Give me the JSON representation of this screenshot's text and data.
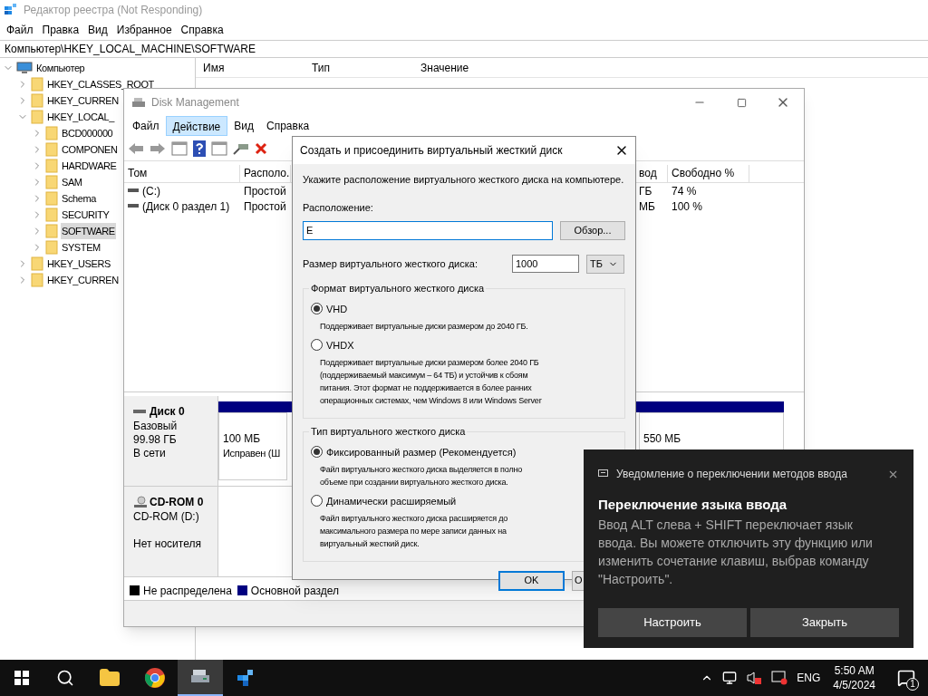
{
  "registry": {
    "title": "Редактор реестра (Not Responding)",
    "menu": [
      "Файл",
      "Правка",
      "Вид",
      "Избранное",
      "Справка"
    ],
    "address": "Компьютер\\HKEY_LOCAL_MACHINE\\SOFTWARE",
    "tree": [
      {
        "label": "Компьютер",
        "kind": "computer",
        "expanded": true,
        "selected": false,
        "children": [
          {
            "label": "HKEY_CLASSES_ROOT",
            "kind": "folder",
            "expanded": false,
            "selected": false
          },
          {
            "label": "HKEY_CURREN",
            "kind": "folder",
            "expanded": false,
            "selected": false
          },
          {
            "label": "HKEY_LOCAL_",
            "kind": "folder",
            "expanded": true,
            "selected": false,
            "children": [
              {
                "label": "BCD000000",
                "kind": "folder",
                "expanded": false,
                "selected": false
              },
              {
                "label": "COMPONEN",
                "kind": "folder",
                "expanded": false,
                "selected": false
              },
              {
                "label": "HARDWARE",
                "kind": "folder",
                "expanded": false,
                "selected": false
              },
              {
                "label": "SAM",
                "kind": "folder",
                "expanded": false,
                "selected": false
              },
              {
                "label": "Schema",
                "kind": "folder",
                "expanded": false,
                "selected": false
              },
              {
                "label": "SECURITY",
                "kind": "folder",
                "expanded": false,
                "selected": false
              },
              {
                "label": "SOFTWARE",
                "kind": "folder",
                "expanded": false,
                "selected": true
              },
              {
                "label": "SYSTEM",
                "kind": "folder",
                "expanded": false,
                "selected": false
              }
            ]
          },
          {
            "label": "HKEY_USERS",
            "kind": "folder",
            "expanded": false,
            "selected": false
          },
          {
            "label": "HKEY_CURREN",
            "kind": "folder",
            "expanded": false,
            "selected": false
          }
        ]
      }
    ],
    "columns": [
      "Имя",
      "Тип",
      "Значение"
    ]
  },
  "disk_management": {
    "title": "Disk Management",
    "menu": [
      {
        "label": "Файл",
        "selected": false
      },
      {
        "label": "Действие",
        "selected": true
      },
      {
        "label": "Вид",
        "selected": false
      },
      {
        "label": "Справка",
        "selected": false
      }
    ],
    "columns": [
      "Том",
      "Располо."
    ],
    "rows": [
      {
        "volume": "(C:)",
        "layout": "Простой"
      },
      {
        "volume": "(Диск 0 раздел 1)",
        "layout": "Простой"
      }
    ],
    "right_columns": [
      "вод",
      "Свободно %"
    ],
    "right_rows": [
      [
        "ГБ",
        "74 %"
      ],
      [
        "МБ",
        "100 %"
      ]
    ],
    "disks": [
      {
        "name": "Диск 0",
        "kind": "disk",
        "lines": [
          "Базовый",
          "99.98 ГБ",
          "В сети"
        ],
        "partitions": [
          {
            "size": "100 МБ",
            "status": "Исправен (Ш"
          },
          {
            "size": "550 МБ"
          }
        ]
      },
      {
        "name": "CD-ROM 0",
        "kind": "cdrom",
        "lines": [
          "CD-ROM (D:)",
          "Нет носителя"
        ]
      }
    ],
    "legend": [
      {
        "label": "Не распределена",
        "color": "#000000"
      },
      {
        "label": "Основной раздел",
        "color": "#000080"
      }
    ]
  },
  "dialog": {
    "title": "Создать и присоединить виртуальный жесткий диск",
    "intro": "Укажите расположение виртуального жесткого диска на компьютере.",
    "location_label": "Расположение:",
    "location_value": "E",
    "browse": "Обзор...",
    "size_label": "Размер виртуального жесткого диска:",
    "size_value": "1000",
    "unit": "ТБ",
    "format_group": {
      "title": "Формат виртуального жесткого диска",
      "options": [
        {
          "label": "VHD",
          "selected": true,
          "lines": [
            "Поддерживает виртуальные диски размером до 2040 ГБ."
          ]
        },
        {
          "label": "VHDX",
          "selected": false,
          "lines": [
            "Поддерживает виртуальные диски размером более 2040 ГБ",
            "(поддерживаемый максимум – 64 ТБ) и устойчив к сбоям",
            "питания. Этот формат не поддерживается в более ранних",
            "операционных системах, чем Windows 8 или Windows Server"
          ]
        }
      ]
    },
    "type_group": {
      "title": "Тип виртуального жесткого диска",
      "options": [
        {
          "label": "Фиксированный размер (Рекомендуется)",
          "selected": true,
          "lines": [
            "Файл виртуального жесткого диска выделяется в полно",
            "объеме при создании виртуального жесткого диска."
          ]
        },
        {
          "label": "Динамически расширяемый",
          "selected": false,
          "lines": [
            "Файл виртуального жесткого диска расширяется до",
            "максимального размера по мере записи данных на",
            "виртуальный жесткий диск."
          ]
        }
      ]
    },
    "ok": "OK",
    "cancel": "О"
  },
  "notification": {
    "source": "Уведомление о переключении методов ввода",
    "heading": "Переключение языка ввода",
    "body": "Ввод ALT слева + SHIFT переключает язык ввода. Вы можете отключить эту функцию или изменить сочетание клавиш, выбрав команду \"Настроить\".",
    "buttons": [
      "Настроить",
      "Закрыть"
    ]
  },
  "taskbar": {
    "apps": [
      {
        "kind": "explorer",
        "active": false
      },
      {
        "kind": "browser",
        "active": false
      },
      {
        "kind": "disk",
        "active": true
      },
      {
        "kind": "registry",
        "active": false
      }
    ],
    "language": "ENG",
    "time": "5:50 AM",
    "date": "4/5/2024",
    "badge": "1"
  }
}
